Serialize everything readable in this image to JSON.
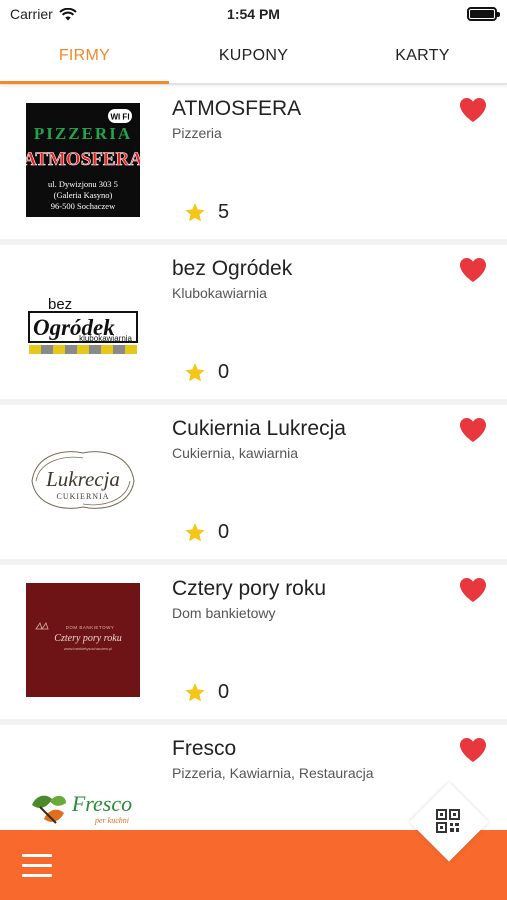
{
  "status_bar": {
    "carrier": "Carrier",
    "time": "1:54 PM"
  },
  "tabs": [
    {
      "label": "FIRMY",
      "active": true
    },
    {
      "label": "KUPONY",
      "active": false
    },
    {
      "label": "KARTY",
      "active": false
    }
  ],
  "accent_color": "#f6882a",
  "bottom_bar_color": "#f7692c",
  "heart_color": "#e8373d",
  "star_color": "#f5c518",
  "companies": [
    {
      "name": "ATMOSFERA",
      "category": "Pizzeria",
      "rating": "5",
      "logo": {
        "type": "atmosfera",
        "badge": "WI FI",
        "line1": "PIZZERIA",
        "line2": "ATMOSFERA",
        "address1": "ul. Dywizjonu 303 5",
        "address2": "(Galeria Kasyno)",
        "address3": "96-500 Sochaczew"
      }
    },
    {
      "name": "bez Ogródek",
      "category": "Klubokawiarnia",
      "rating": "0",
      "logo": {
        "type": "ogrodek",
        "line1": "bez",
        "line2": "Ogródek",
        "line3": "klubokawiarnia"
      }
    },
    {
      "name": "Cukiernia Lukrecja",
      "category": "Cukiernia, kawiarnia",
      "rating": "0",
      "logo": {
        "type": "lukrecja",
        "line1": "Lukrecja",
        "line2": "CUKIERNIA"
      }
    },
    {
      "name": "Cztery pory roku",
      "category": "Dom bankietowy",
      "rating": "0",
      "logo": {
        "type": "cztery",
        "line1": "DOM BANKIETOWY",
        "line2": "Cztery pory roku",
        "line3": "www.bankietysochaczew.pl"
      }
    },
    {
      "name": "Fresco",
      "category": "Pizzeria, Kawiarnia, Restauracja",
      "rating": "0",
      "logo": {
        "type": "fresco",
        "line1": "Fresco",
        "line2": "per kuchni"
      }
    }
  ]
}
